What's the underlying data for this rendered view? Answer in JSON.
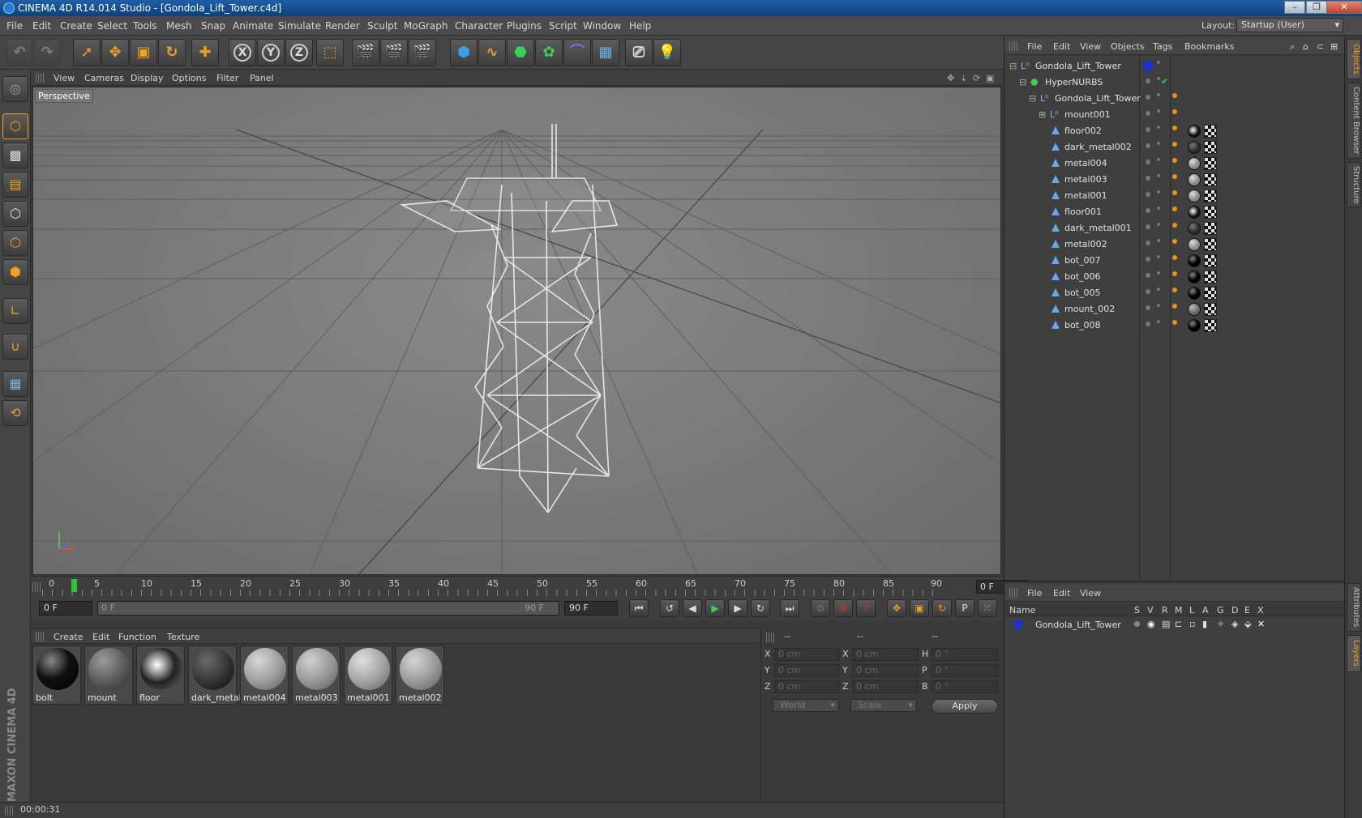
{
  "window": {
    "title": "CINEMA 4D R14.014 Studio - [Gondola_Lift_Tower.c4d]"
  },
  "menu": [
    "File",
    "Edit",
    "Create",
    "Select",
    "Tools",
    "Mesh",
    "Snap",
    "Animate",
    "Simulate",
    "Render",
    "Sculpt",
    "MoGraph",
    "Character",
    "Plugins",
    "Script",
    "Window",
    "Help"
  ],
  "layout": {
    "label": "Layout:",
    "value": "Startup (User)"
  },
  "viewport": {
    "menu": [
      "View",
      "Cameras",
      "Display",
      "Options",
      "Filter",
      "Panel"
    ],
    "label": "Perspective"
  },
  "timeline": {
    "ticks": [
      "0",
      "5",
      "10",
      "15",
      "20",
      "25",
      "30",
      "35",
      "40",
      "45",
      "50",
      "55",
      "60",
      "65",
      "70",
      "75",
      "80",
      "85",
      "90"
    ],
    "current_frame": "0 F",
    "start": "0 F",
    "range_left": "0 F",
    "range_right": "90 F",
    "end": "90 F"
  },
  "materials": {
    "menu": [
      "Create",
      "Edit",
      "Function",
      "Texture"
    ],
    "items": [
      {
        "name": "bolt"
      },
      {
        "name": "mount"
      },
      {
        "name": "floor"
      },
      {
        "name": "dark_metal"
      },
      {
        "name": "metal004"
      },
      {
        "name": "metal003"
      },
      {
        "name": "metal001"
      },
      {
        "name": "metal002"
      }
    ]
  },
  "coords": {
    "headers": [
      "--",
      "--",
      "--"
    ],
    "rows": [
      {
        "a": "X",
        "av": "0 cm",
        "b": "X",
        "bv": "0 cm",
        "c": "H",
        "cv": "0 °"
      },
      {
        "a": "Y",
        "av": "0 cm",
        "b": "Y",
        "bv": "0 cm",
        "c": "P",
        "cv": "0 °"
      },
      {
        "a": "Z",
        "av": "0 cm",
        "b": "Z",
        "bv": "0 cm",
        "c": "B",
        "cv": "0 °"
      }
    ],
    "space": "World",
    "mode": "Scale",
    "apply": "Apply"
  },
  "status": {
    "time": "00:00:31"
  },
  "objects": {
    "menu": [
      "File",
      "Edit",
      "View",
      "Objects",
      "Tags",
      "Bookmarks"
    ],
    "items": [
      {
        "name": "Gondola_Lift_Tower",
        "indent": 0,
        "type": "null"
      },
      {
        "name": "HyperNURBS",
        "indent": 1,
        "type": "nurbs"
      },
      {
        "name": "Gondola_Lift_Tower",
        "indent": 2,
        "type": "null"
      },
      {
        "name": "mount001",
        "indent": 3,
        "type": "null"
      },
      {
        "name": "floor002",
        "indent": 4,
        "type": "mesh"
      },
      {
        "name": "dark_metal002",
        "indent": 4,
        "type": "mesh"
      },
      {
        "name": "metal004",
        "indent": 4,
        "type": "mesh"
      },
      {
        "name": "metal003",
        "indent": 4,
        "type": "mesh"
      },
      {
        "name": "metal001",
        "indent": 4,
        "type": "mesh"
      },
      {
        "name": "floor001",
        "indent": 4,
        "type": "mesh"
      },
      {
        "name": "dark_metal001",
        "indent": 4,
        "type": "mesh"
      },
      {
        "name": "metal002",
        "indent": 4,
        "type": "mesh"
      },
      {
        "name": "bot_007",
        "indent": 4,
        "type": "mesh"
      },
      {
        "name": "bot_006",
        "indent": 4,
        "type": "mesh"
      },
      {
        "name": "bot_005",
        "indent": 4,
        "type": "mesh"
      },
      {
        "name": "mount_002",
        "indent": 4,
        "type": "mesh"
      },
      {
        "name": "bot_008",
        "indent": 4,
        "type": "mesh"
      }
    ]
  },
  "layers": {
    "menu": [
      "File",
      "Edit",
      "View"
    ],
    "columns": [
      "Name",
      "S",
      "V",
      "R",
      "M",
      "L",
      "A",
      "G",
      "D",
      "E",
      "X"
    ],
    "items": [
      {
        "name": "Gondola_Lift_Tower",
        "color": "#1a2fd8"
      }
    ]
  },
  "side_tabs": [
    "Objects",
    "Content Browser",
    "Structure",
    "Attributes",
    "Layers"
  ],
  "colors": {
    "accent": "#f0a020",
    "selection_blue": "#1a2fd8",
    "timeline_cursor": "#2ec43a"
  }
}
